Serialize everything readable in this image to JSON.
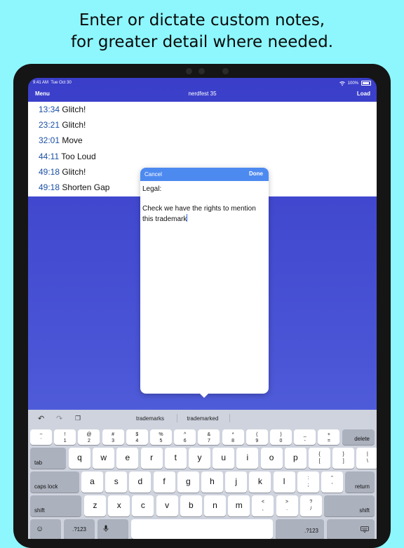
{
  "headline": {
    "line1": "Enter or dictate custom notes,",
    "line2": "for greater detail where needed."
  },
  "status_bar": {
    "time": "9:41 AM",
    "date": "Tue Oct 30",
    "battery": "100%",
    "icons": [
      "wifi-icon",
      "battery-icon"
    ]
  },
  "nav": {
    "left": "Menu",
    "title": "nerdfest 35",
    "right": "Load"
  },
  "markers": [
    {
      "time": "13:34",
      "label": "Glitch!"
    },
    {
      "time": "23:21",
      "label": "Glitch!"
    },
    {
      "time": "32:01",
      "label": "Move"
    },
    {
      "time": "44:11",
      "label": "Too Loud"
    },
    {
      "time": "49:18",
      "label": "Glitch!"
    },
    {
      "time": "49:18",
      "label": "Shorten Gap"
    }
  ],
  "note_dialog": {
    "cancel": "Cancel",
    "done": "Done",
    "line1": "Legal:",
    "line2": "Check we have the rights to mention",
    "line3": "this trademark"
  },
  "keyboard": {
    "suggestions": [
      "trademarks",
      "trademarked"
    ],
    "toolbar_icons": [
      "undo-icon",
      "redo-icon",
      "paste-icon"
    ],
    "row1": [
      {
        "top": "~",
        "bottom": "`"
      },
      {
        "top": "!",
        "bottom": "1"
      },
      {
        "top": "@",
        "bottom": "2"
      },
      {
        "top": "#",
        "bottom": "3"
      },
      {
        "top": "$",
        "bottom": "4"
      },
      {
        "top": "%",
        "bottom": "5"
      },
      {
        "top": "^",
        "bottom": "6"
      },
      {
        "top": "&",
        "bottom": "7"
      },
      {
        "top": "*",
        "bottom": "8"
      },
      {
        "top": "(",
        "bottom": "9"
      },
      {
        "top": ")",
        "bottom": "0"
      },
      {
        "top": "_",
        "bottom": "-"
      },
      {
        "top": "+",
        "bottom": "="
      }
    ],
    "delete": "delete",
    "tab": "tab",
    "row2": [
      "q",
      "w",
      "e",
      "r",
      "t",
      "y",
      "u",
      "i",
      "o",
      "p"
    ],
    "row2_extra": [
      {
        "top": "{",
        "bottom": "["
      },
      {
        "top": "}",
        "bottom": "]"
      },
      {
        "top": "|",
        "bottom": "\\"
      }
    ],
    "caps": "caps lock",
    "row3": [
      "a",
      "s",
      "d",
      "f",
      "g",
      "h",
      "j",
      "k",
      "l"
    ],
    "row3_extra": [
      {
        "top": ":",
        "bottom": ";"
      },
      {
        "top": "\"",
        "bottom": "'"
      }
    ],
    "return": "return",
    "shift": "shift",
    "row4": [
      "z",
      "x",
      "c",
      "v",
      "b",
      "n",
      "m"
    ],
    "row4_extra": [
      {
        "top": "<",
        "bottom": ","
      },
      {
        "top": ">",
        "bottom": "."
      },
      {
        "top": "?",
        "bottom": "/"
      }
    ],
    "numbers": ".?123",
    "bottom_icons": [
      "emoji-icon",
      "microphone-icon",
      "keyboard-dismiss-icon"
    ]
  }
}
